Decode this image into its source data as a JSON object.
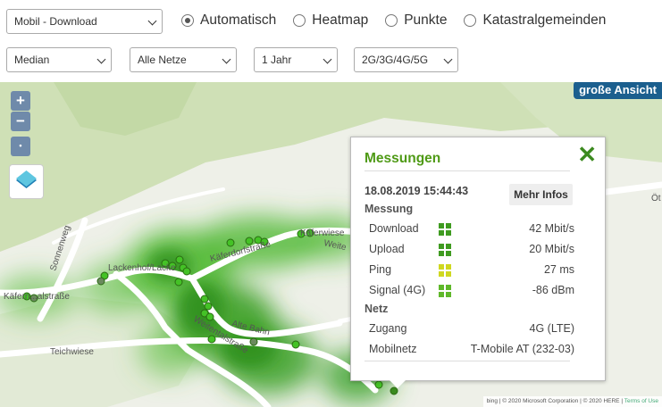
{
  "controls": {
    "type_select": "Mobil - Download",
    "stat_select": "Median",
    "network_select": "Alle Netze",
    "time_select": "1 Jahr",
    "tech_select": "2G/3G/4G/5G",
    "view_modes": [
      {
        "label": "Automatisch",
        "checked": true
      },
      {
        "label": "Heatmap",
        "checked": false
      },
      {
        "label": "Punkte",
        "checked": false
      },
      {
        "label": "Katastralgemeinden",
        "checked": false
      }
    ]
  },
  "map": {
    "zoom_in": "+",
    "zoom_out": "−",
    "locate": "•",
    "big_view": "große Ansicht",
    "street_labels": [
      "Sonnenweg",
      "Lackenhof/Lacke",
      "Käfern...alstraße",
      "Käferdorfstraße",
      "Käferwiese",
      "Weite",
      "Alte Bahn",
      "Weitentalstraße",
      "Teichwiese",
      "Öt"
    ],
    "attribution": {
      "provider": "bing",
      "copyright1": "© 2020 Microsoft Corporation",
      "copyright2": "© 2020 HERE",
      "terms": "Terms of Use"
    }
  },
  "popup": {
    "title": "Messungen",
    "close": "✕",
    "timestamp": "18.08.2019 15:44:43",
    "more_info": "Mehr Infos",
    "measurement_heading": "Messung",
    "measurements": [
      {
        "label": "Download",
        "value": "42 Mbit/s",
        "quality_color": "#3f9b20"
      },
      {
        "label": "Upload",
        "value": "20 Mbit/s",
        "quality_color": "#3f9b20"
      },
      {
        "label": "Ping",
        "value": "27 ms",
        "quality_color": "#cfd820"
      },
      {
        "label": "Signal (4G)",
        "value": "-86 dBm",
        "quality_color": "#5fb82a"
      }
    ],
    "network_heading": "Netz",
    "network": [
      {
        "label": "Zugang",
        "value": "4G (LTE)"
      },
      {
        "label": "Mobilnetz",
        "value": "T-Mobile AT (232-03)"
      }
    ]
  }
}
